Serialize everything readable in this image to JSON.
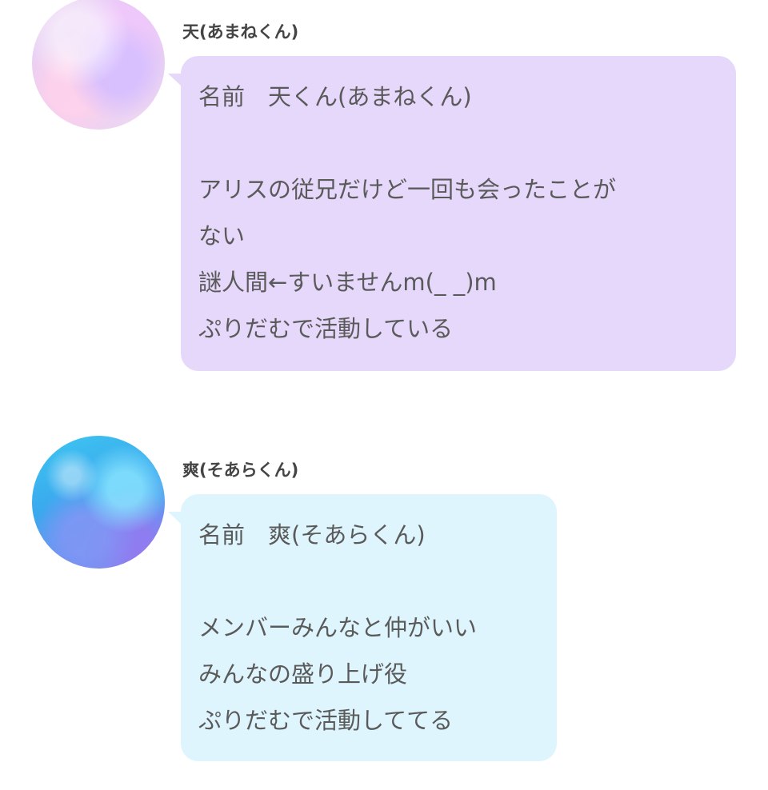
{
  "messages": [
    {
      "sender": "天(あまねくん)",
      "avatar": "avatar-purple-nebula",
      "bubble_color": "#e6d8fb",
      "lines": [
        "名前　天くん(あまねくん)",
        "",
        "アリスの従兄だけど一回も会ったことが",
        "ない",
        "謎人間←すいませんm(_ _)m",
        "ぷりだむで活動している"
      ]
    },
    {
      "sender": "爽(そあらくん)",
      "avatar": "avatar-blue-galaxy",
      "bubble_color": "#dff5fd",
      "lines": [
        "名前　爽(そあらくん)",
        "",
        "メンバーみんなと仲がいい",
        "みんなの盛り上げ役",
        "ぷりだむで活動しててる"
      ]
    }
  ]
}
